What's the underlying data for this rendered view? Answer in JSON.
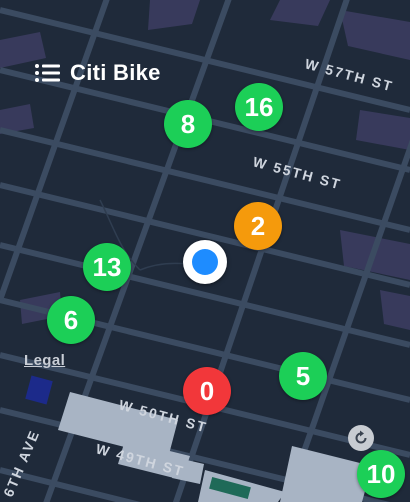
{
  "header": {
    "title": "Citi Bike",
    "menu_icon": "menu-icon"
  },
  "streets": {
    "w57": "W 57TH ST",
    "w55": "W 55TH ST",
    "w50": "W 50TH ST",
    "w49": "W 49TH ST",
    "ave6": "6TH AVE"
  },
  "legal_label": "Legal",
  "markers": [
    {
      "count": "16",
      "color": "#1ccf57"
    },
    {
      "count": "8",
      "color": "#1ccf57"
    },
    {
      "count": "2",
      "color": "#f59a0c"
    },
    {
      "count": "13",
      "color": "#1ccf57"
    },
    {
      "count": "6",
      "color": "#1ccf57"
    },
    {
      "count": "5",
      "color": "#1ccf57"
    },
    {
      "count": "0",
      "color": "#f2373a"
    },
    {
      "count": "10",
      "color": "#1ccf57"
    }
  ],
  "colors": {
    "background": "#1f2a3a",
    "road": "#3a4a5f",
    "building": "#3a3a5c",
    "park": "#aab6c6",
    "user": "#1e8cff"
  },
  "icons": {
    "recenter": "recenter-icon"
  }
}
